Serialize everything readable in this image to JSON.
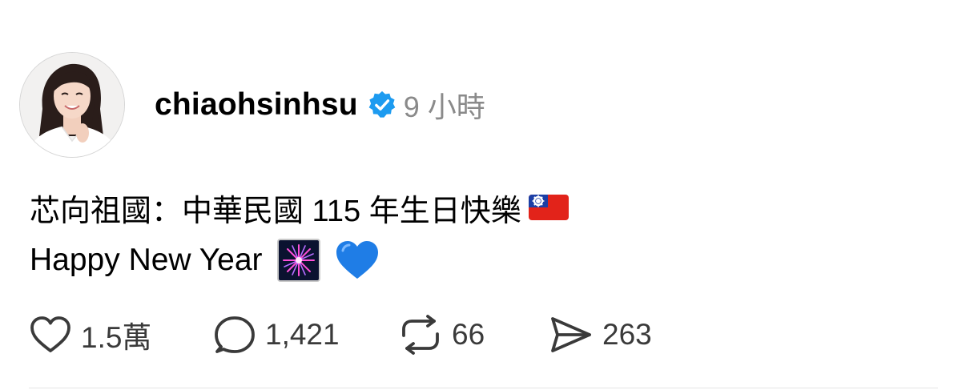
{
  "post": {
    "username": "chiaohsinhsu",
    "verified": true,
    "timestamp": "9 小時",
    "text_line1": "芯向祖國：中華民國 115 年生日快樂",
    "text_line2": "Happy New Year",
    "emojis": [
      "taiwan-flag",
      "fireworks",
      "blue-heart"
    ],
    "colors": {
      "verified": "#1d9bf0",
      "timestamp": "#8a8a8a",
      "heart_emoji": "#1f7de6",
      "icon": "#3a3a3a"
    }
  },
  "actions": {
    "like_count": "1.5萬",
    "comment_count": "1,421",
    "repost_count": "66",
    "share_count": "263",
    "icons": [
      "heart-outline",
      "speech-bubble",
      "repost-arrows",
      "paper-plane"
    ]
  }
}
